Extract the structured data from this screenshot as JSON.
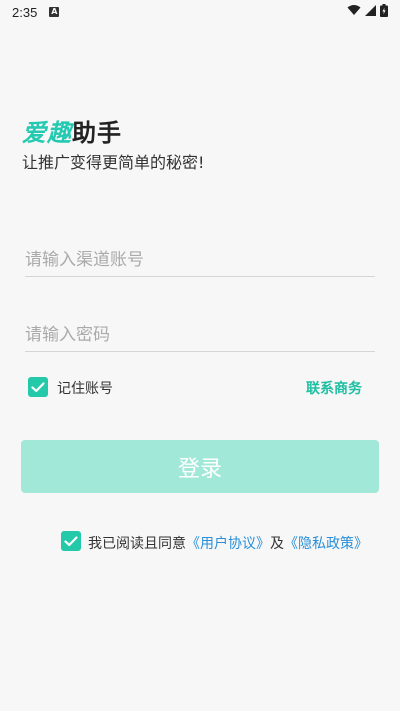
{
  "status_bar": {
    "time": "2:35",
    "notification_icon": "a-icon",
    "wifi_icon": "wifi-icon",
    "signal_icon": "signal-icon",
    "battery_icon": "battery-icon"
  },
  "header": {
    "title_accent": "爱趣",
    "title_rest": "助手",
    "subtitle": "让推广变得更简单的秘密!"
  },
  "form": {
    "channel_account_placeholder": "请输入渠道账号",
    "password_placeholder": "请输入密码",
    "remember_label": "记住账号",
    "remember_checked": true,
    "contact_label": "联系商务",
    "login_label": "登录"
  },
  "agreement": {
    "checked": true,
    "prefix": "我已阅读且同意",
    "user_agreement": "《用户协议》",
    "conjunction": "及",
    "privacy_policy": "《隐私政策》"
  },
  "colors": {
    "accent": "#23c9b0",
    "button_disabled": "#a2e8d9",
    "link": "#2a8fd8",
    "background": "#f7f7f7"
  }
}
